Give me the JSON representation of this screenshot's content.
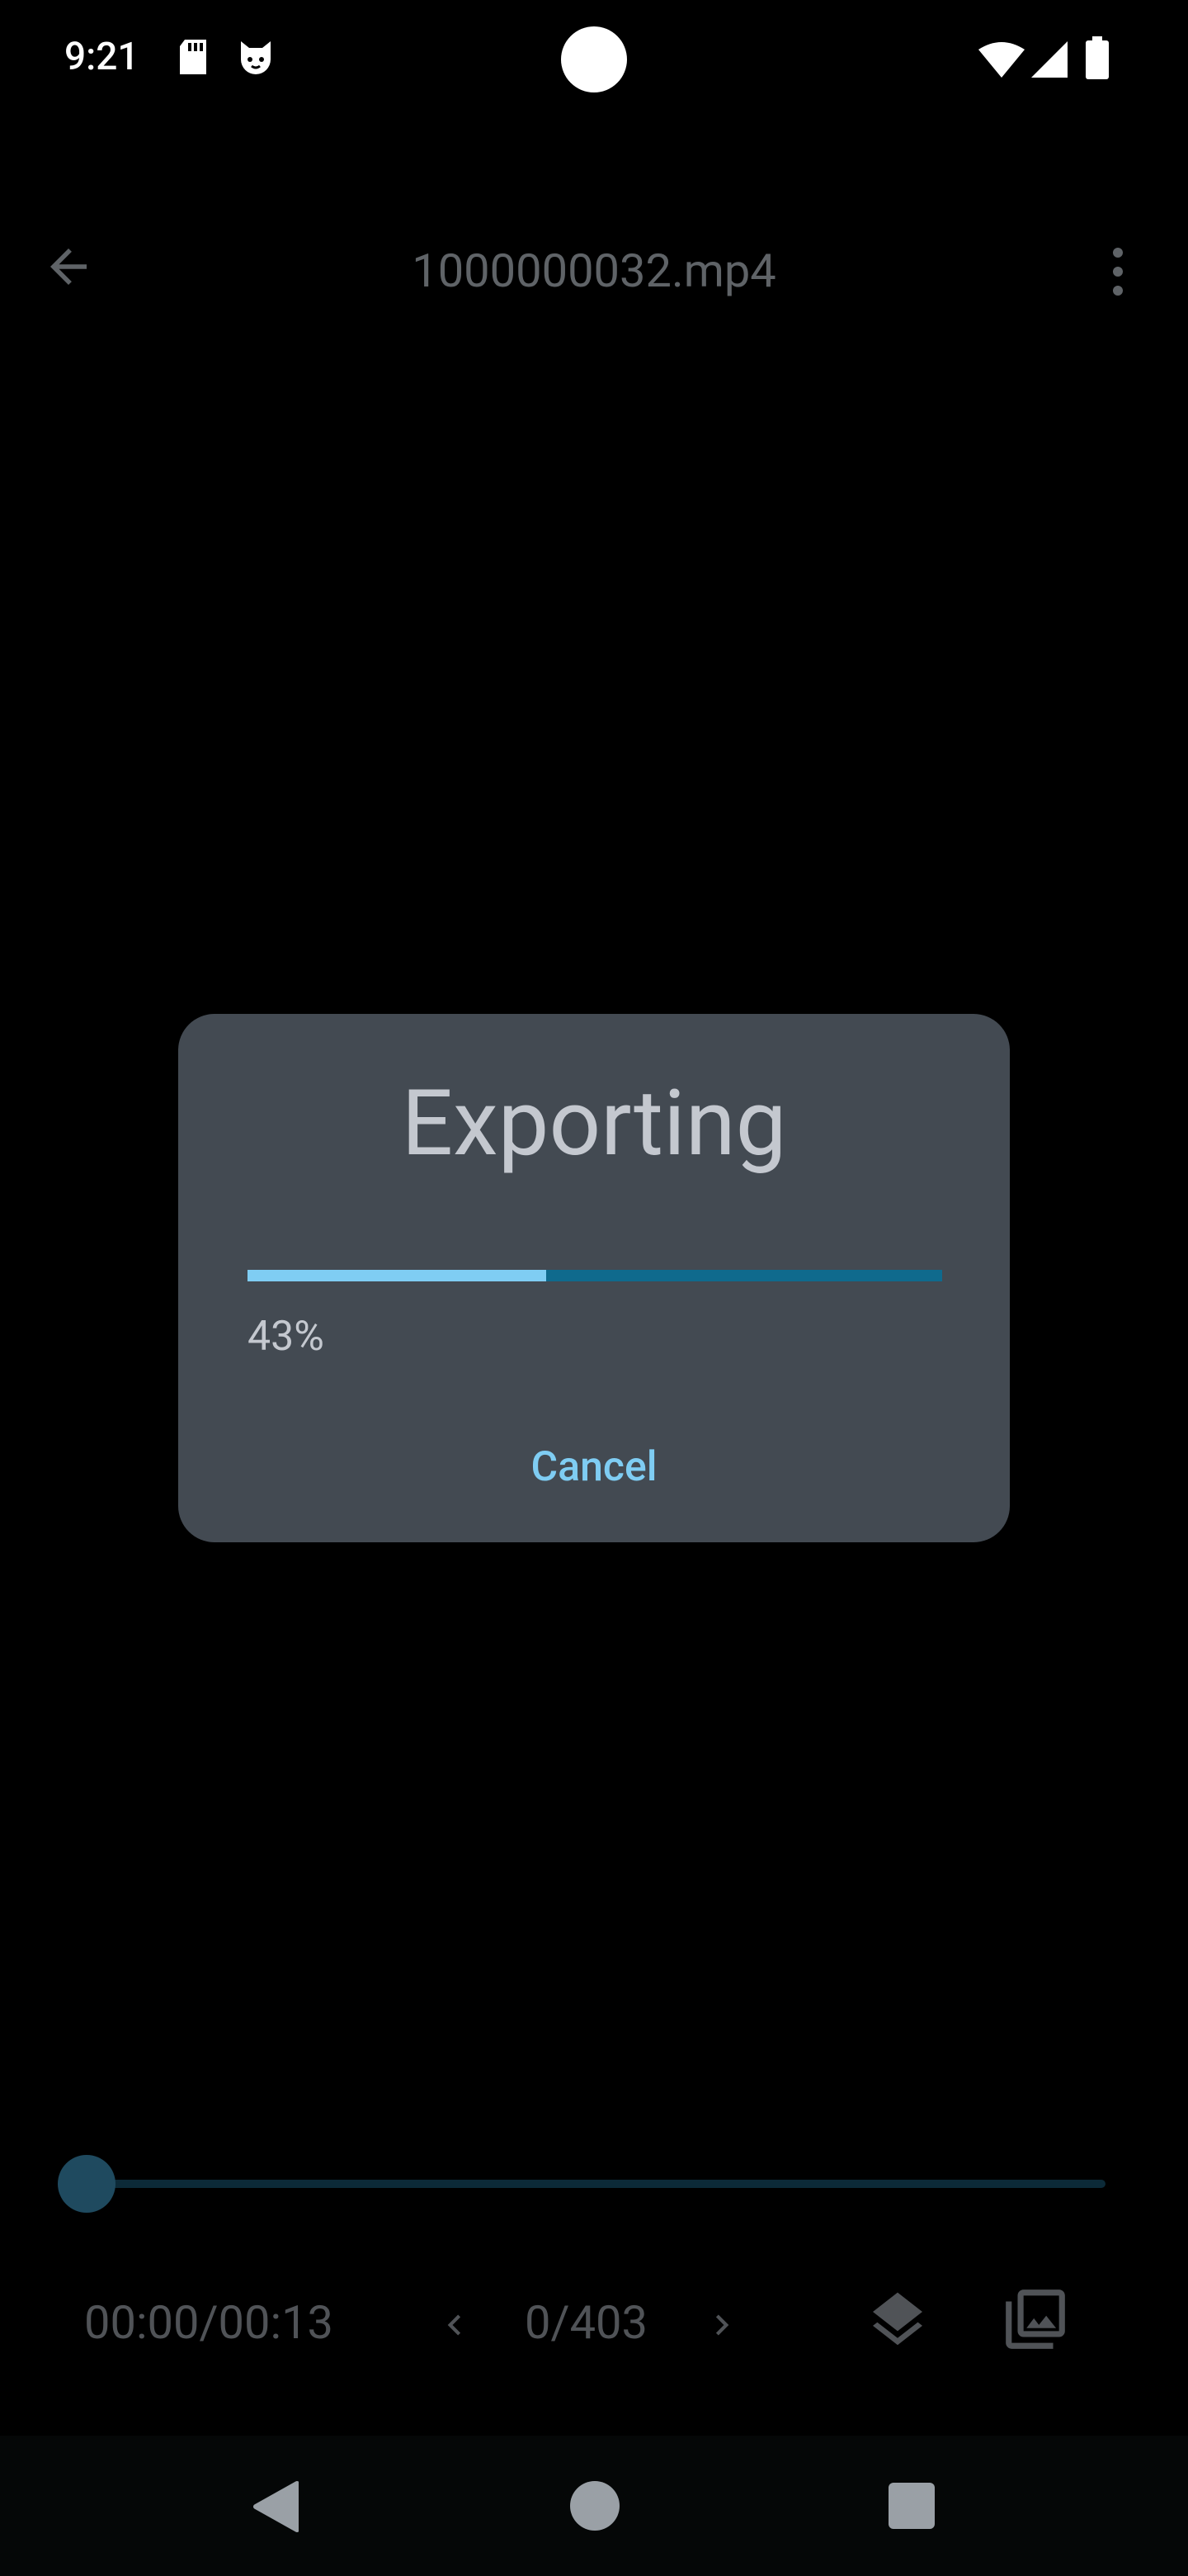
{
  "status_bar": {
    "time": "9:21",
    "icons": [
      "sd-card-icon",
      "cat-icon",
      "wifi-icon",
      "signal-icon",
      "battery-icon"
    ]
  },
  "app_bar": {
    "title": "1000000032.mp4",
    "back_icon": "arrow-back-icon",
    "menu_icon": "more-vert-icon"
  },
  "dialog": {
    "title": "Exporting",
    "progress_percent": 43,
    "progress_text": "43%",
    "cancel_label": "Cancel",
    "colors": {
      "background": "#434a52",
      "accent": "#7fcdf3",
      "track": "#0f6a8d"
    }
  },
  "player": {
    "timecode": "00:00/00:13",
    "frame_counter": "0/403",
    "seek_position_fraction": 0.0,
    "icons": [
      "chevron-left-icon",
      "chevron-right-icon",
      "layers-icon",
      "gallery-icon"
    ]
  },
  "nav_bar": {
    "icons": [
      "nav-back-icon",
      "nav-home-icon",
      "nav-recents-icon"
    ]
  }
}
